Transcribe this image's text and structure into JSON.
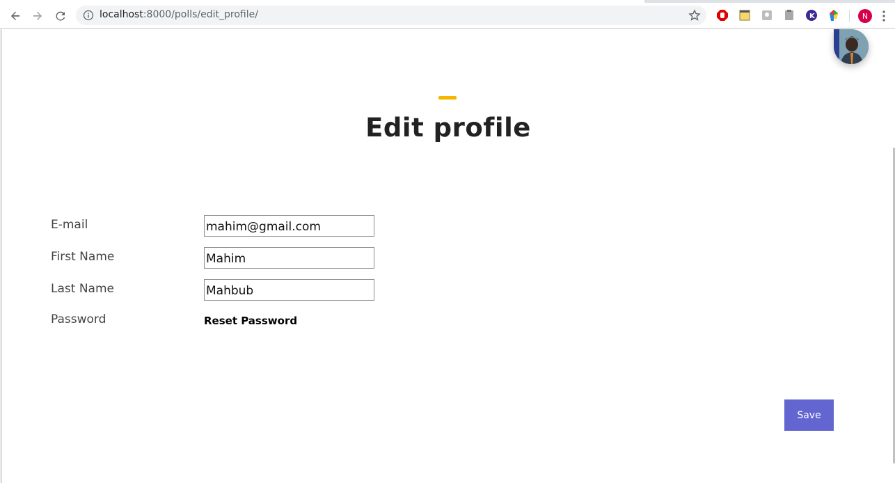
{
  "browser": {
    "url_host": "localhost",
    "url_path": ":8000/polls/edit_profile/",
    "profile_initial": "N",
    "extensions": [
      "adblock-icon",
      "notes-icon",
      "extension-gray-icon",
      "extension-clip-icon",
      "k-extension-icon",
      "color-picker-icon"
    ]
  },
  "page": {
    "title": "Edit profile",
    "accent_color": "#f7b500",
    "form": {
      "email_label": "E-mail",
      "email_value": "mahim@gmail.com",
      "first_name_label": "First Name",
      "first_name_value": "Mahim",
      "last_name_label": "Last Name",
      "last_name_value": "Mahbub",
      "password_label": "Password",
      "reset_password_link": "Reset Password"
    },
    "save_label": "Save",
    "save_color": "#6366d1"
  }
}
